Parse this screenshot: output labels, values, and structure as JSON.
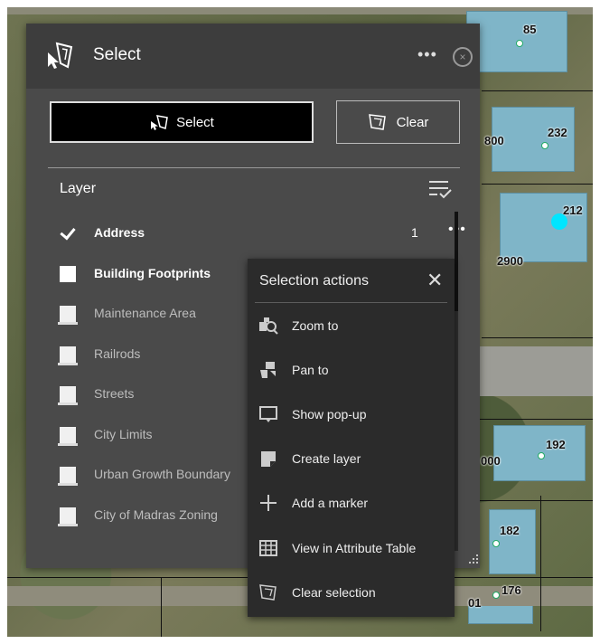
{
  "widget": {
    "title": "Select",
    "more_label": "•••",
    "close_label": "×"
  },
  "buttons": {
    "select_label": "Select",
    "clear_label": "Clear"
  },
  "layers": {
    "header": "Layer",
    "items": [
      {
        "label": "Address",
        "checked": true,
        "count": "1",
        "more": "•••"
      },
      {
        "label": "Building Footprints",
        "checked": false
      },
      {
        "label": "Maintenance Area",
        "checked": false
      },
      {
        "label": "Railrods",
        "checked": false
      },
      {
        "label": "Streets",
        "checked": false
      },
      {
        "label": "City Limits",
        "checked": false
      },
      {
        "label": "Urban Growth Boundary",
        "checked": false
      },
      {
        "label": "City of Madras Zoning",
        "checked": false
      }
    ]
  },
  "selection_actions": {
    "title": "Selection actions",
    "close_label": "✕",
    "items": [
      {
        "label": "Zoom to",
        "icon": "zoom-to-icon"
      },
      {
        "label": "Pan to",
        "icon": "pan-to-icon"
      },
      {
        "label": "Show pop-up",
        "icon": "popup-icon"
      },
      {
        "label": "Create layer",
        "icon": "create-layer-icon"
      },
      {
        "label": "Add a marker",
        "icon": "add-marker-icon"
      },
      {
        "label": "View in Attribute Table",
        "icon": "table-icon"
      },
      {
        "label": "Clear selection",
        "icon": "clear-selection-icon"
      }
    ]
  },
  "map_labels": [
    "85",
    "800",
    "232",
    "212",
    "2900",
    "192",
    "000",
    "182",
    "176",
    "01"
  ],
  "colors": {
    "panel": "#4a4a4a",
    "header": "#3d3d3d",
    "popup": "#2b2b2b",
    "selected_point": "#00e5ff"
  }
}
